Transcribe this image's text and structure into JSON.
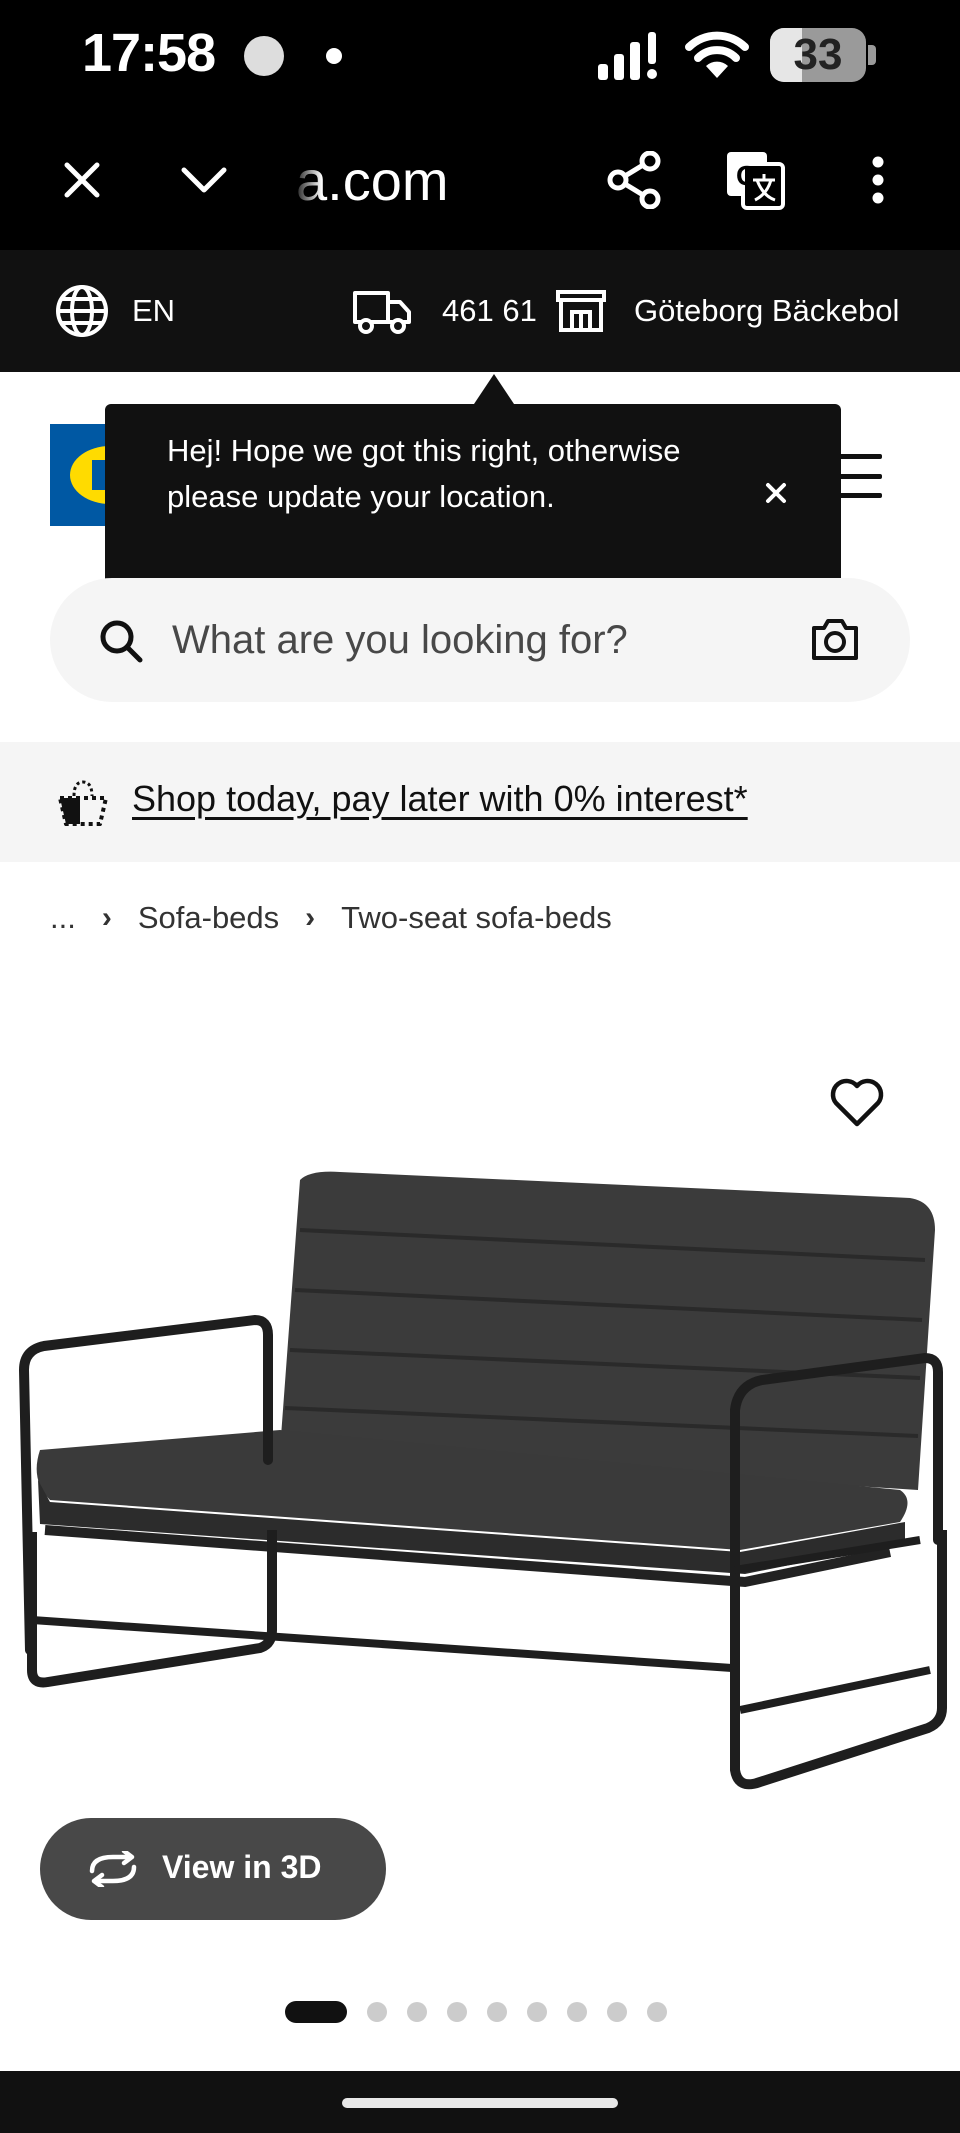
{
  "status_bar": {
    "time": "17:58",
    "battery": "33",
    "battery_level": 0.33,
    "icons": [
      "app-notification-icon",
      "dot-icon",
      "signal-icon",
      "wifi-icon",
      "battery-icon"
    ]
  },
  "browser": {
    "url": "a.com",
    "icons": [
      "close-icon",
      "chevron-down-icon",
      "share-icon",
      "translate-icon",
      "more-vert-icon"
    ]
  },
  "location_bar": {
    "language": "EN",
    "postal_code": "461 61",
    "store": "Göteborg Bäckebol"
  },
  "tooltip": {
    "message": "Hej! Hope we got this right, otherwise please update your location."
  },
  "search": {
    "placeholder": "What are you looking for?"
  },
  "promo": {
    "text": "Shop today, pay later with 0% interest*"
  },
  "breadcrumb": {
    "items": [
      "...",
      "Sofa-beds",
      "Two-seat sofa-beds"
    ]
  },
  "product": {
    "view_3d_label": "View in 3D",
    "image_count": 9,
    "active_image_index": 0
  },
  "colors": {
    "ikea_blue": "#0058a3",
    "ikea_yellow": "#ffdb00",
    "dark": "#111111",
    "button_gray": "#484848"
  }
}
